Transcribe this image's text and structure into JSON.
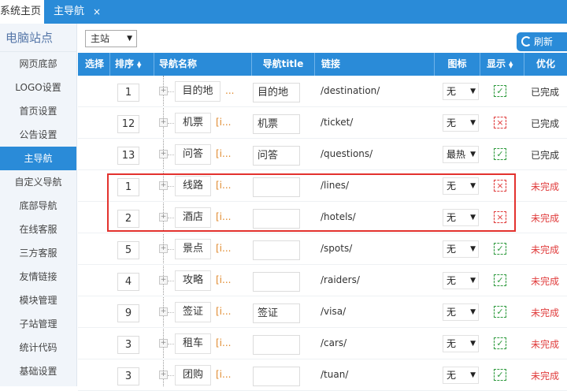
{
  "tabs": {
    "home_label": "系统主页",
    "active_label": "主导航",
    "close_glyph": "×"
  },
  "sidebar": {
    "title": "电脑站点",
    "items": [
      {
        "label": "网页底部"
      },
      {
        "label": "LOGO设置"
      },
      {
        "label": "首页设置"
      },
      {
        "label": "公告设置"
      },
      {
        "label": "主导航",
        "active": true
      },
      {
        "label": "自定义导航"
      },
      {
        "label": "底部导航"
      },
      {
        "label": "在线客服"
      },
      {
        "label": "三方客服"
      },
      {
        "label": "友情链接"
      },
      {
        "label": "模块管理"
      },
      {
        "label": "子站管理"
      },
      {
        "label": "统计代码"
      },
      {
        "label": "基础设置"
      }
    ]
  },
  "toolbar": {
    "station_select": "主站",
    "refresh_label": "刷新"
  },
  "table": {
    "headers": {
      "select": "选择",
      "sort": "排序",
      "nav_name": "导航名称",
      "nav_title": "导航title",
      "link": "链接",
      "icon": "图标",
      "show": "显示",
      "optimize": "优化"
    },
    "rows": [
      {
        "order": "1",
        "name": "目的地",
        "note": "...",
        "title": "目的地",
        "link": "/destination/",
        "icon": "无",
        "show": true,
        "status": "已完成",
        "done": true
      },
      {
        "order": "12",
        "name": "机票",
        "note": "[i...",
        "title": "机票",
        "link": "/ticket/",
        "icon": "无",
        "show": false,
        "status": "已完成",
        "done": true
      },
      {
        "order": "13",
        "name": "问答",
        "note": "[i...",
        "title": "问答",
        "link": "/questions/",
        "icon": "最热",
        "show": true,
        "status": "已完成",
        "done": true
      },
      {
        "order": "1",
        "name": "线路",
        "note": "[i...",
        "title": "",
        "link": "/lines/",
        "icon": "无",
        "show": false,
        "status": "未完成",
        "done": false
      },
      {
        "order": "2",
        "name": "酒店",
        "note": "[i...",
        "title": "",
        "link": "/hotels/",
        "icon": "无",
        "show": false,
        "status": "未完成",
        "done": false
      },
      {
        "order": "5",
        "name": "景点",
        "note": "[i...",
        "title": "",
        "link": "/spots/",
        "icon": "无",
        "show": true,
        "status": "未完成",
        "done": false
      },
      {
        "order": "4",
        "name": "攻略",
        "note": "[i...",
        "title": "",
        "link": "/raiders/",
        "icon": "无",
        "show": true,
        "status": "未完成",
        "done": false
      },
      {
        "order": "9",
        "name": "签证",
        "note": "[i...",
        "title": "签证",
        "link": "/visa/",
        "icon": "无",
        "show": true,
        "status": "未完成",
        "done": false
      },
      {
        "order": "3",
        "name": "租车",
        "note": "[i...",
        "title": "",
        "link": "/cars/",
        "icon": "无",
        "show": true,
        "status": "未完成",
        "done": false
      },
      {
        "order": "3",
        "name": "团购",
        "note": "[i...",
        "title": "",
        "link": "/tuan/",
        "icon": "无",
        "show": true,
        "status": "未完成",
        "done": false
      }
    ]
  },
  "colors": {
    "accent": "#2a8bd8",
    "done_text": "#333333",
    "todo_text": "#e03c3c",
    "show_on": "#2e9a3e",
    "show_off": "#e03c3c",
    "highlight": "#e3322e"
  },
  "icons": {
    "checked": "✓",
    "unchecked": "×",
    "plus": "+",
    "caret": "▼",
    "sort": "▲▼"
  }
}
